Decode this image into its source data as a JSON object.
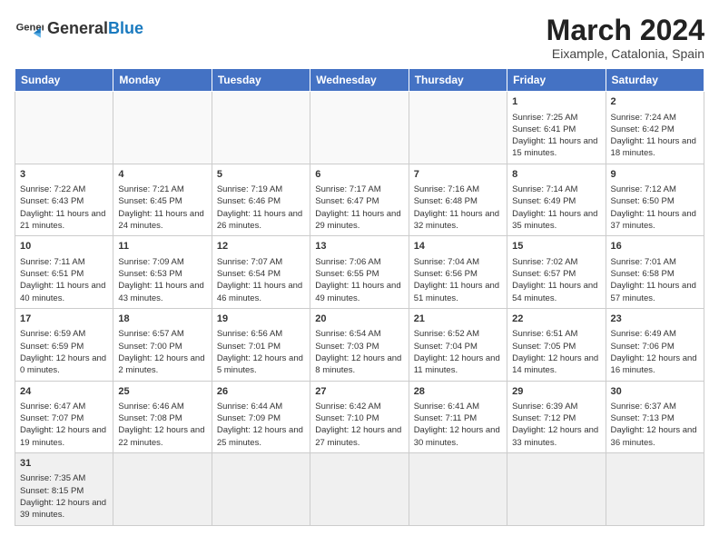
{
  "header": {
    "logo_text_normal": "General",
    "logo_text_bold": "Blue",
    "month_year": "March 2024",
    "location": "Eixample, Catalonia, Spain"
  },
  "weekdays": [
    "Sunday",
    "Monday",
    "Tuesday",
    "Wednesday",
    "Thursday",
    "Friday",
    "Saturday"
  ],
  "weeks": [
    [
      {
        "day": "",
        "info": ""
      },
      {
        "day": "",
        "info": ""
      },
      {
        "day": "",
        "info": ""
      },
      {
        "day": "",
        "info": ""
      },
      {
        "day": "",
        "info": ""
      },
      {
        "day": "1",
        "info": "Sunrise: 7:25 AM\nSunset: 6:41 PM\nDaylight: 11 hours and 15 minutes."
      },
      {
        "day": "2",
        "info": "Sunrise: 7:24 AM\nSunset: 6:42 PM\nDaylight: 11 hours and 18 minutes."
      }
    ],
    [
      {
        "day": "3",
        "info": "Sunrise: 7:22 AM\nSunset: 6:43 PM\nDaylight: 11 hours and 21 minutes."
      },
      {
        "day": "4",
        "info": "Sunrise: 7:21 AM\nSunset: 6:45 PM\nDaylight: 11 hours and 24 minutes."
      },
      {
        "day": "5",
        "info": "Sunrise: 7:19 AM\nSunset: 6:46 PM\nDaylight: 11 hours and 26 minutes."
      },
      {
        "day": "6",
        "info": "Sunrise: 7:17 AM\nSunset: 6:47 PM\nDaylight: 11 hours and 29 minutes."
      },
      {
        "day": "7",
        "info": "Sunrise: 7:16 AM\nSunset: 6:48 PM\nDaylight: 11 hours and 32 minutes."
      },
      {
        "day": "8",
        "info": "Sunrise: 7:14 AM\nSunset: 6:49 PM\nDaylight: 11 hours and 35 minutes."
      },
      {
        "day": "9",
        "info": "Sunrise: 7:12 AM\nSunset: 6:50 PM\nDaylight: 11 hours and 37 minutes."
      }
    ],
    [
      {
        "day": "10",
        "info": "Sunrise: 7:11 AM\nSunset: 6:51 PM\nDaylight: 11 hours and 40 minutes."
      },
      {
        "day": "11",
        "info": "Sunrise: 7:09 AM\nSunset: 6:53 PM\nDaylight: 11 hours and 43 minutes."
      },
      {
        "day": "12",
        "info": "Sunrise: 7:07 AM\nSunset: 6:54 PM\nDaylight: 11 hours and 46 minutes."
      },
      {
        "day": "13",
        "info": "Sunrise: 7:06 AM\nSunset: 6:55 PM\nDaylight: 11 hours and 49 minutes."
      },
      {
        "day": "14",
        "info": "Sunrise: 7:04 AM\nSunset: 6:56 PM\nDaylight: 11 hours and 51 minutes."
      },
      {
        "day": "15",
        "info": "Sunrise: 7:02 AM\nSunset: 6:57 PM\nDaylight: 11 hours and 54 minutes."
      },
      {
        "day": "16",
        "info": "Sunrise: 7:01 AM\nSunset: 6:58 PM\nDaylight: 11 hours and 57 minutes."
      }
    ],
    [
      {
        "day": "17",
        "info": "Sunrise: 6:59 AM\nSunset: 6:59 PM\nDaylight: 12 hours and 0 minutes."
      },
      {
        "day": "18",
        "info": "Sunrise: 6:57 AM\nSunset: 7:00 PM\nDaylight: 12 hours and 2 minutes."
      },
      {
        "day": "19",
        "info": "Sunrise: 6:56 AM\nSunset: 7:01 PM\nDaylight: 12 hours and 5 minutes."
      },
      {
        "day": "20",
        "info": "Sunrise: 6:54 AM\nSunset: 7:03 PM\nDaylight: 12 hours and 8 minutes."
      },
      {
        "day": "21",
        "info": "Sunrise: 6:52 AM\nSunset: 7:04 PM\nDaylight: 12 hours and 11 minutes."
      },
      {
        "day": "22",
        "info": "Sunrise: 6:51 AM\nSunset: 7:05 PM\nDaylight: 12 hours and 14 minutes."
      },
      {
        "day": "23",
        "info": "Sunrise: 6:49 AM\nSunset: 7:06 PM\nDaylight: 12 hours and 16 minutes."
      }
    ],
    [
      {
        "day": "24",
        "info": "Sunrise: 6:47 AM\nSunset: 7:07 PM\nDaylight: 12 hours and 19 minutes."
      },
      {
        "day": "25",
        "info": "Sunrise: 6:46 AM\nSunset: 7:08 PM\nDaylight: 12 hours and 22 minutes."
      },
      {
        "day": "26",
        "info": "Sunrise: 6:44 AM\nSunset: 7:09 PM\nDaylight: 12 hours and 25 minutes."
      },
      {
        "day": "27",
        "info": "Sunrise: 6:42 AM\nSunset: 7:10 PM\nDaylight: 12 hours and 27 minutes."
      },
      {
        "day": "28",
        "info": "Sunrise: 6:41 AM\nSunset: 7:11 PM\nDaylight: 12 hours and 30 minutes."
      },
      {
        "day": "29",
        "info": "Sunrise: 6:39 AM\nSunset: 7:12 PM\nDaylight: 12 hours and 33 minutes."
      },
      {
        "day": "30",
        "info": "Sunrise: 6:37 AM\nSunset: 7:13 PM\nDaylight: 12 hours and 36 minutes."
      }
    ],
    [
      {
        "day": "31",
        "info": "Sunrise: 7:35 AM\nSunset: 8:15 PM\nDaylight: 12 hours and 39 minutes."
      },
      {
        "day": "",
        "info": ""
      },
      {
        "day": "",
        "info": ""
      },
      {
        "day": "",
        "info": ""
      },
      {
        "day": "",
        "info": ""
      },
      {
        "day": "",
        "info": ""
      },
      {
        "day": "",
        "info": ""
      }
    ]
  ]
}
